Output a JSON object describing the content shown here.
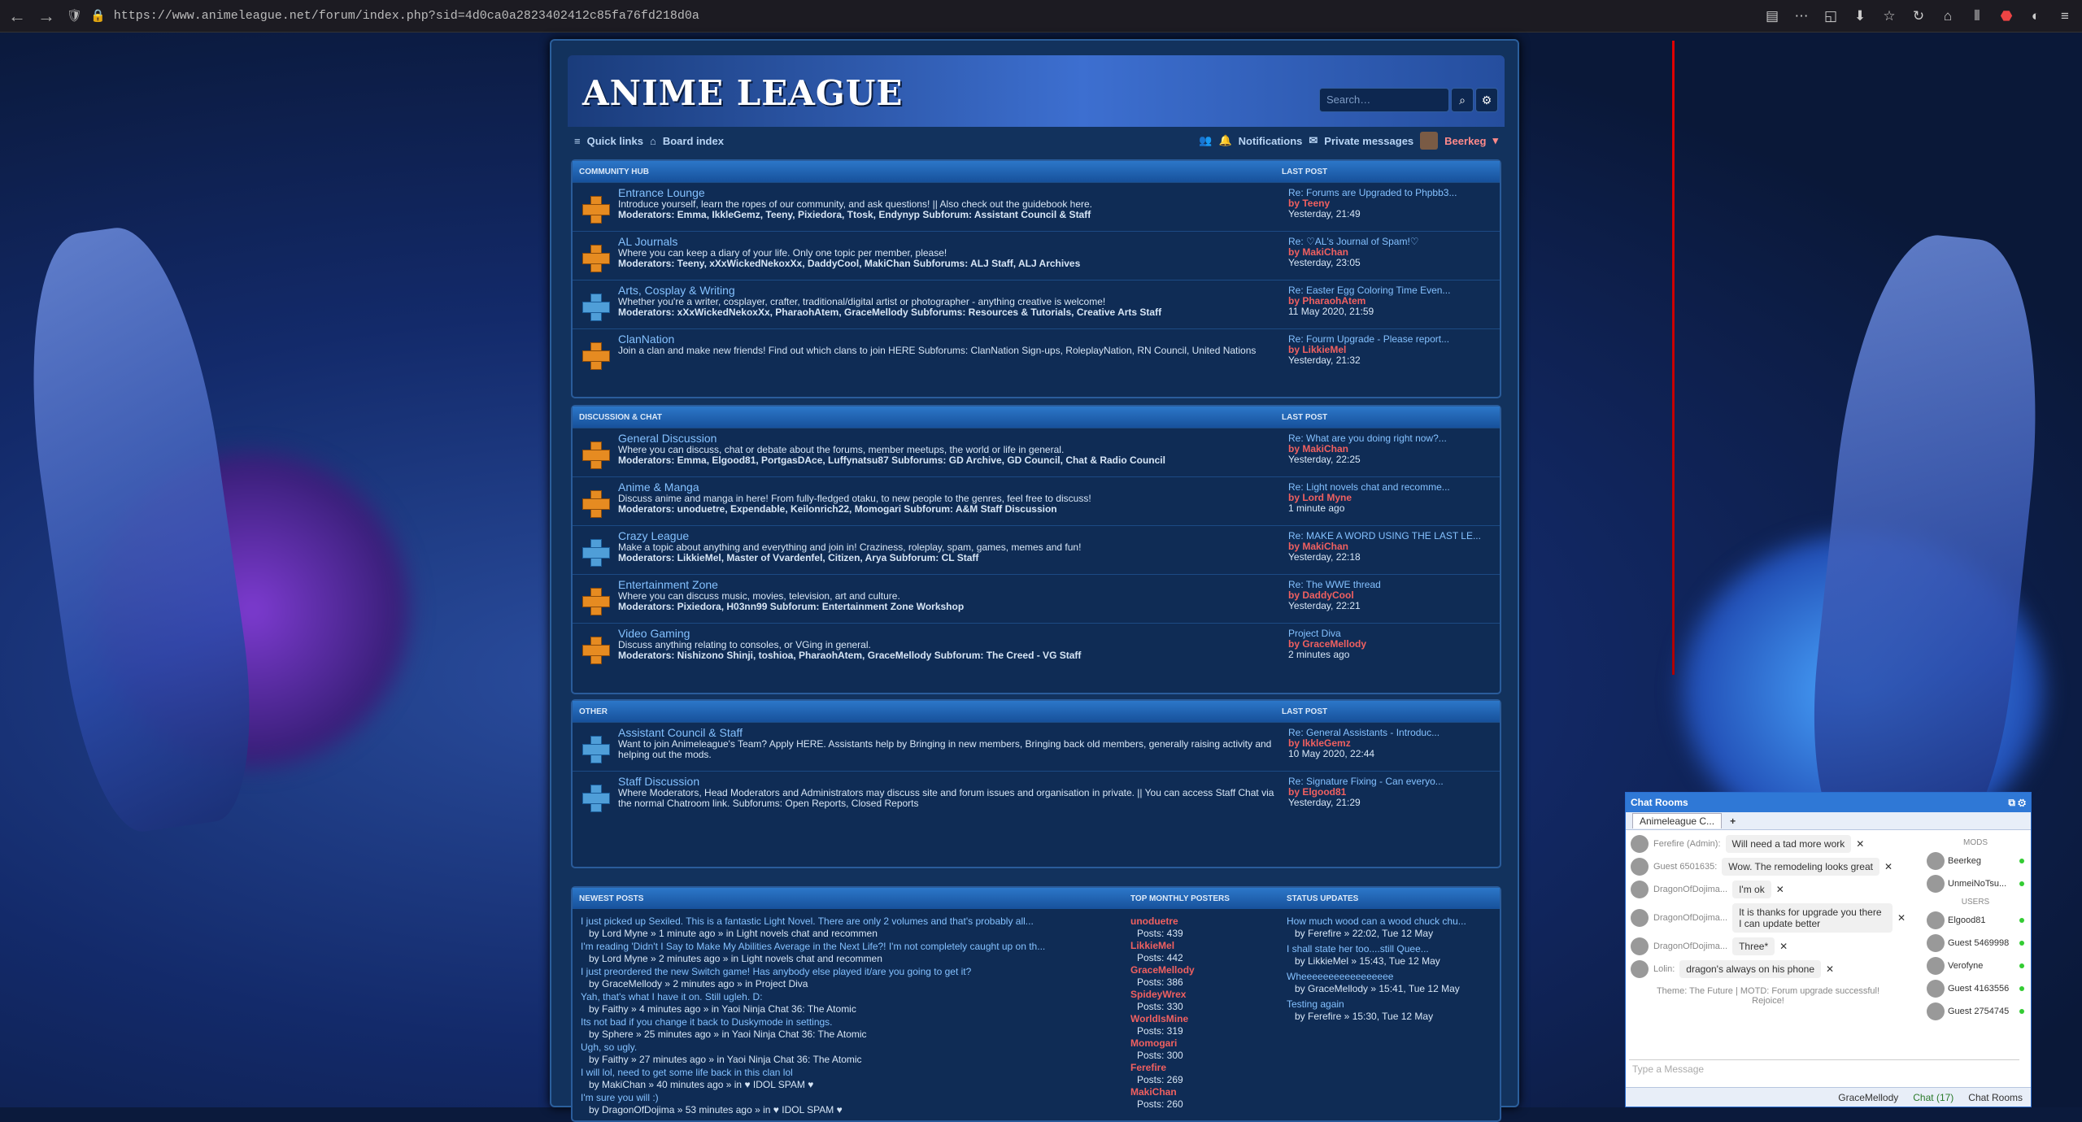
{
  "browser": {
    "url": "https://www.animeleague.net/forum/index.php?sid=4d0ca0a2823402412c85fa76fd218d0a"
  },
  "header": {
    "logo": "ANIME LEAGUE",
    "search_placeholder": "Search…"
  },
  "nav": {
    "quick_links": "Quick links",
    "board_index": "Board index",
    "notifications": "Notifications",
    "private_messages": "Private messages",
    "user": "Beerkeg"
  },
  "sections": [
    {
      "title": "COMMUNITY HUB",
      "last_post": "LAST POST",
      "forums": [
        {
          "title": "Entrance Lounge",
          "desc": "Introduce yourself, learn the ropes of our community, and ask questions! || Also check out the guidebook here.",
          "mods": "Moderators: Emma, IkkleGemz, Teeny, Pixiedora, Ttosk, Endynyp Subforum: Assistant Council & Staff",
          "lp_t": "Re: Forums are Upgraded to Phpbb3...",
          "lp_u": "by Teeny",
          "lp_d": "Yesterday, 21:49"
        },
        {
          "title": "AL Journals",
          "desc": "Where you can keep a diary of your life. Only one topic per member, please!",
          "mods": "Moderators: Teeny, xXxWickedNekoxXx, DaddyCool, MakiChan Subforums: ALJ Staff, ALJ Archives",
          "lp_t": "Re: ♡AL's Journal of Spam!♡",
          "lp_u": "by MakiChan",
          "lp_d": "Yesterday, 23:05"
        },
        {
          "title": "Arts, Cosplay & Writing",
          "desc": "Whether you're a writer, cosplayer, crafter, traditional/digital artist or photographer - anything creative is welcome!",
          "mods": "Moderators: xXxWickedNekoxXx, PharaohAtem, GraceMellody Subforums: Resources & Tutorials, Creative Arts Staff",
          "lp_t": "Re: Easter Egg Coloring Time Even...",
          "lp_u": "by PharaohAtem",
          "lp_d": "11 May 2020, 21:59"
        },
        {
          "title": "ClanNation",
          "desc": "Join a clan and make new friends! Find out which clans to join HERE Subforums: ClanNation Sign-ups, RoleplayNation, RN Council, United Nations",
          "mods": "",
          "lp_t": "Re: Fourm Upgrade - Please report...",
          "lp_u": "by LikkieMel",
          "lp_d": "Yesterday, 21:32"
        }
      ]
    },
    {
      "title": "DISCUSSION & CHAT",
      "last_post": "LAST POST",
      "forums": [
        {
          "title": "General Discussion",
          "desc": "Where you can discuss, chat or debate about the forums, member meetups, the world or life in general.",
          "mods": "Moderators: Emma, Elgood81, PortgasDAce, Luffynatsu87 Subforums: GD Archive, GD Council, Chat & Radio Council",
          "lp_t": "Re: What are you doing right now?...",
          "lp_u": "by MakiChan",
          "lp_d": "Yesterday, 22:25"
        },
        {
          "title": "Anime & Manga",
          "desc": "Discuss anime and manga in here! From fully-fledged otaku, to new people to the genres, feel free to discuss!",
          "mods": "Moderators: unoduetre, Expendable, Keilonrich22, Momogari Subforum: A&M Staff Discussion",
          "lp_t": "Re: Light novels chat and recomme...",
          "lp_u": "by Lord Myne",
          "lp_d": "1 minute ago"
        },
        {
          "title": "Crazy League",
          "desc": "Make a topic about anything and everything and join in! Craziness, roleplay, spam, games, memes and fun!",
          "mods": "Moderators: LikkieMel, Master of Vvardenfel, Citizen, Arya Subforum: CL Staff",
          "lp_t": "Re: MAKE A WORD USING THE LAST LE...",
          "lp_u": "by MakiChan",
          "lp_d": "Yesterday, 22:18"
        },
        {
          "title": "Entertainment Zone",
          "desc": "Where you can discuss music, movies, television, art and culture.",
          "mods": "Moderators: Pixiedora, H03nn99 Subforum: Entertainment Zone Workshop",
          "lp_t": "Re: The WWE thread",
          "lp_u": "by DaddyCool",
          "lp_d": "Yesterday, 22:21"
        },
        {
          "title": "Video Gaming",
          "desc": "Discuss anything relating to consoles, or VGing in general.",
          "mods": "Moderators: Nishizono Shinji, toshioa, PharaohAtem, GraceMellody Subforum: The Creed - VG Staff",
          "lp_t": "Project Diva",
          "lp_u": "by GraceMellody",
          "lp_d": "2 minutes ago"
        }
      ]
    },
    {
      "title": "OTHER",
      "last_post": "LAST POST",
      "forums": [
        {
          "title": "Assistant Council & Staff",
          "desc": "Want to join Animeleague's Team? Apply HERE. Assistants help by Bringing in new members, Bringing back old members, generally raising activity and helping out the mods.",
          "mods": "",
          "lp_t": "Re: General Assistants - Introduc...",
          "lp_u": "by IkkleGemz",
          "lp_d": "10 May 2020, 22:44"
        },
        {
          "title": "Staff Discussion",
          "desc": "Where Moderators, Head Moderators and Administrators may discuss site and forum issues and organisation in private. || You can access Staff Chat via the normal Chatroom link. Subforums: Open Reports, Closed Reports",
          "mods": "",
          "lp_t": "Re: Signature Fixing - Can everyo...",
          "lp_u": "by Elgood81",
          "lp_d": "Yesterday, 21:29"
        }
      ]
    }
  ],
  "newest": {
    "title": "NEWEST POSTS",
    "top_title": "TOP MONTHLY POSTERS",
    "status_title": "STATUS UPDATES",
    "posts": [
      {
        "t": "I just picked up Sexiled. This is a fantastic Light Novel. There are only 2 volumes and that's probably all...",
        "b": "by Lord Myne » 1 minute ago » in Light novels chat and recommen"
      },
      {
        "t": "I'm reading 'Didn't I Say to Make My Abilities Average in the Next Life?! I'm not completely caught up on th...",
        "b": "by Lord Myne » 2 minutes ago » in Light novels chat and recommen"
      },
      {
        "t": "I just preordered the new Switch game! Has anybody else played it/are you going to get it?",
        "b": "by GraceMellody » 2 minutes ago » in Project Diva"
      },
      {
        "t": "Yah, that's what I have it on. Still ugleh. D:",
        "b": "by Faithy » 4 minutes ago » in Yaoi Ninja Chat 36: The Atomic"
      },
      {
        "t": "Its not bad if you change it back to Duskymode in settings.",
        "b": "by Sphere » 25 minutes ago » in Yaoi Ninja Chat 36: The Atomic"
      },
      {
        "t": "Ugh, so ugly.",
        "b": "by Faithy » 27 minutes ago » in Yaoi Ninja Chat 36: The Atomic"
      },
      {
        "t": "I will lol, need to get some life back in this clan lol",
        "b": "by MakiChan » 40 minutes ago » in ♥ IDOL SPAM ♥"
      },
      {
        "t": "I'm sure you will :)",
        "b": "by DragonOfDojima » 53 minutes ago » in ♥ IDOL SPAM ♥"
      }
    ],
    "top": [
      {
        "n": "unoduetre",
        "p": "Posts: 439"
      },
      {
        "n": "LikkieMel",
        "p": "Posts: 442"
      },
      {
        "n": "GraceMellody",
        "p": "Posts: 386"
      },
      {
        "n": "SpideyWrex",
        "p": "Posts: 330"
      },
      {
        "n": "WorldIsMine",
        "p": "Posts: 319"
      },
      {
        "n": "Momogari",
        "p": "Posts: 300"
      },
      {
        "n": "Ferefire",
        "p": "Posts: 269"
      },
      {
        "n": "MakiChan",
        "p": "Posts: 260"
      }
    ],
    "status": [
      {
        "t": "How much wood can a wood chuck chu...",
        "b": "by Ferefire » 22:02, Tue 12 May"
      },
      {
        "t": "I shall state her too....still Quee...",
        "b": "by LikkieMel » 15:43, Tue 12 May"
      },
      {
        "t": "Wheeeeeeeeeeeeeeeee",
        "b": "by GraceMellody » 15:41, Tue 12 May"
      },
      {
        "t": "Testing again",
        "b": "by Ferefire » 15:30, Tue 12 May"
      }
    ]
  },
  "chat": {
    "title": "Chat Rooms",
    "tab": "Animeleague C...",
    "messages": [
      {
        "n": "Ferefire (Admin):",
        "t": "Will need a tad more work"
      },
      {
        "n": "Guest 6501635:",
        "t": "Wow. The remodeling looks great"
      },
      {
        "n": "DragonOfDojima...",
        "t": "I'm ok"
      },
      {
        "n": "DragonOfDojima...",
        "t": "It is thanks for upgrade you there I can update better"
      },
      {
        "n": "DragonOfDojima...",
        "t": "Three*"
      },
      {
        "n": "Lolin:",
        "t": "dragon's always on his phone"
      }
    ],
    "theme": "Theme: The Future | MOTD: Forum upgrade successful! Rejoice!",
    "input_placeholder": "Type a Message",
    "mods_h": "MODS",
    "users_h": "USERS",
    "users": [
      "Beerkeg",
      "UnmeiNoTsu...",
      "Elgood81",
      "Guest 5469998",
      "Verofyne",
      "Guest 4163556",
      "Guest 2754745"
    ],
    "foot_user": "GraceMellody",
    "foot_chat": "Chat (17)",
    "foot_rooms": "Chat Rooms"
  }
}
